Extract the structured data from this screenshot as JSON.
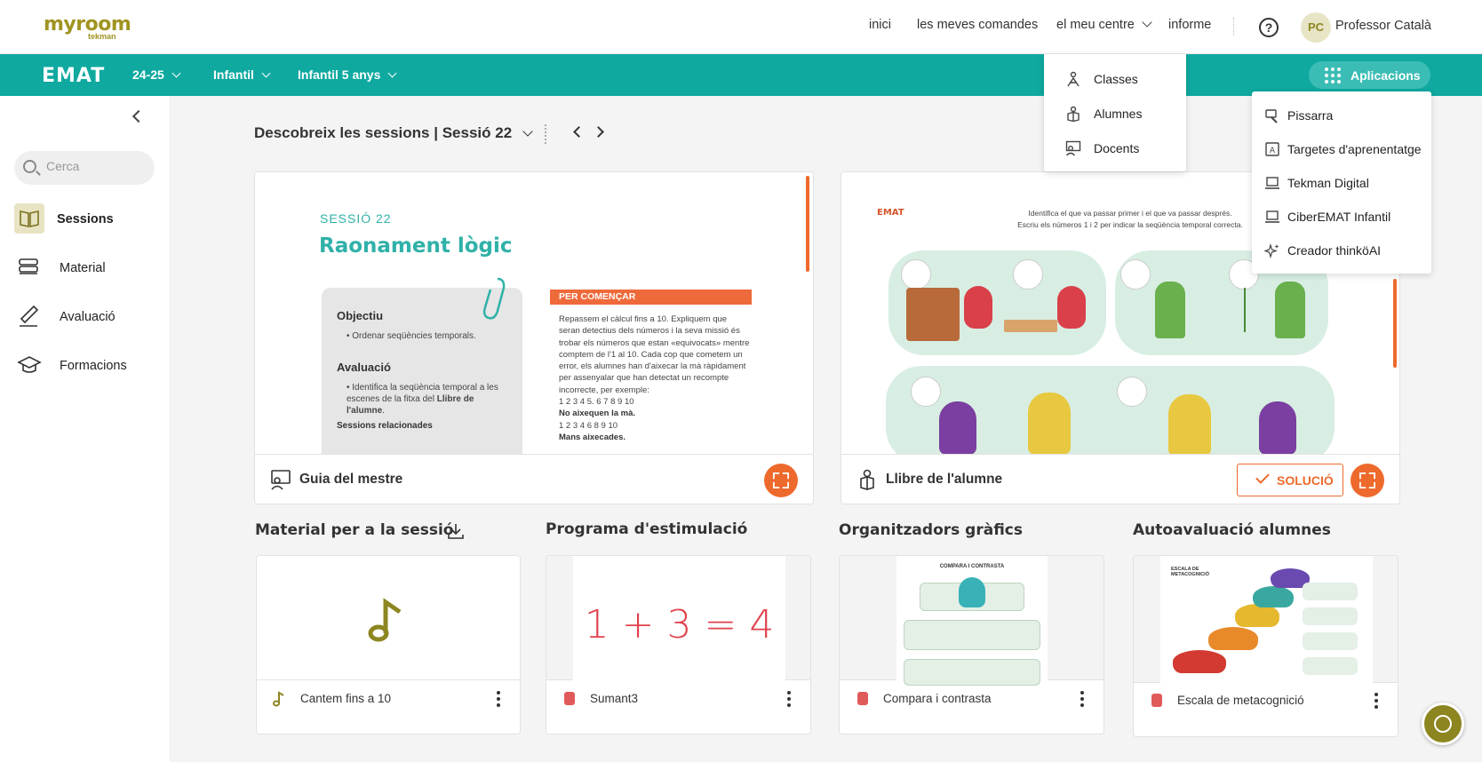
{
  "brand": {
    "logo": "myroom",
    "logo_sub": "tekman",
    "product": "EMAT"
  },
  "topnav": {
    "home": "inici",
    "orders": "les meves comandes",
    "center": "el meu centre",
    "report": "informe"
  },
  "user": {
    "initials": "PC",
    "name": "Professor Català"
  },
  "selectors": {
    "year": "24-25",
    "stage": "Infantil",
    "level": "Infantil 5 anys"
  },
  "apps_button": "Aplicacions",
  "sidebar": {
    "search_placeholder": "Cerca",
    "items": [
      {
        "label": "Sessions",
        "icon": "book-icon",
        "active": true
      },
      {
        "label": "Material",
        "icon": "stack-icon",
        "active": false
      },
      {
        "label": "Avaluació",
        "icon": "pen-icon",
        "active": false
      },
      {
        "label": "Formacions",
        "icon": "graduation-cap-icon",
        "active": false
      }
    ]
  },
  "session": {
    "title": "Descobreix les sessions | Sessió 22"
  },
  "guide_card": {
    "footer": "Guia del mestre",
    "preview": {
      "session_label": "SESSIÓ 22",
      "title": "Raonament lògic",
      "objective_h": "Objectiu",
      "objective": "Ordenar seqüències temporals.",
      "eval_h": "Avaluació",
      "eval_1": "Identifica la seqüència temporal a les escenes de la fitxa del",
      "eval_2": "Llibre de l'alumne",
      "related": "Sessions relacionades",
      "start_h": "PER COMENÇAR",
      "start_text": "Repassem el càlcul fins a 10. Expliquem que seran detectius dels números i la seva missió és trobar els números que estan «equivocats» mentre comptem de l'1 al 10. Cada cop que cometem un error, els alumnes han d'aixecar la mà ràpidament per assenyalar que han detectat un recompte incorrecte, per exemple:",
      "seq1": "1 2 3 4 5. 6 7 8 9 10",
      "note1": "No aixequen la mà.",
      "seq2": "1 2 3 4 6 8 9 10",
      "note2": "Mans aixecades."
    }
  },
  "student_card": {
    "footer": "Llibre de l'alumne",
    "solution": "SOLUCIÓ",
    "preview": {
      "logo": "EMAT",
      "instr_1": "Identifica el que va passar primer i el que va passar després.",
      "instr_2": "Escriu els números 1 i 2 per indicar la seqüència temporal correcta."
    }
  },
  "sections": [
    {
      "title": "Material per a la sessió",
      "item": "Cantem fins a 10",
      "kind": "music"
    },
    {
      "title": "Programa d'estimulació",
      "item": "Sumant3",
      "kind": "pdf",
      "preview": "1 + 3 = 4"
    },
    {
      "title": "Organitzadors gràfics",
      "item": "Compara i contrasta",
      "kind": "pdf",
      "preview_title": "COMPARA I CONTRASTA"
    },
    {
      "title": "Autoavaluació alumnes",
      "item": "Escala de metacognició",
      "kind": "pdf",
      "preview_title": "ESCALA DE METACOGNICIÓ"
    }
  ],
  "center_menu": [
    {
      "label": "Classes",
      "icon": "classes-icon"
    },
    {
      "label": "Alumnes",
      "icon": "student-icon"
    },
    {
      "label": "Docents",
      "icon": "teacher-icon"
    }
  ],
  "apps_menu": [
    {
      "label": "Pissarra",
      "icon": "whiteboard-icon"
    },
    {
      "label": "Targetes d'aprenentatge",
      "icon": "card-icon"
    },
    {
      "label": "Tekman Digital",
      "icon": "laptop-icon"
    },
    {
      "label": "CiberEMAT Infantil",
      "icon": "laptop-icon"
    },
    {
      "label": "Creador thinköAI",
      "icon": "sparkle-icon"
    }
  ],
  "colors": {
    "teal": "#0fa9a0",
    "olive": "#a09422",
    "orange": "#ee6a2c"
  }
}
